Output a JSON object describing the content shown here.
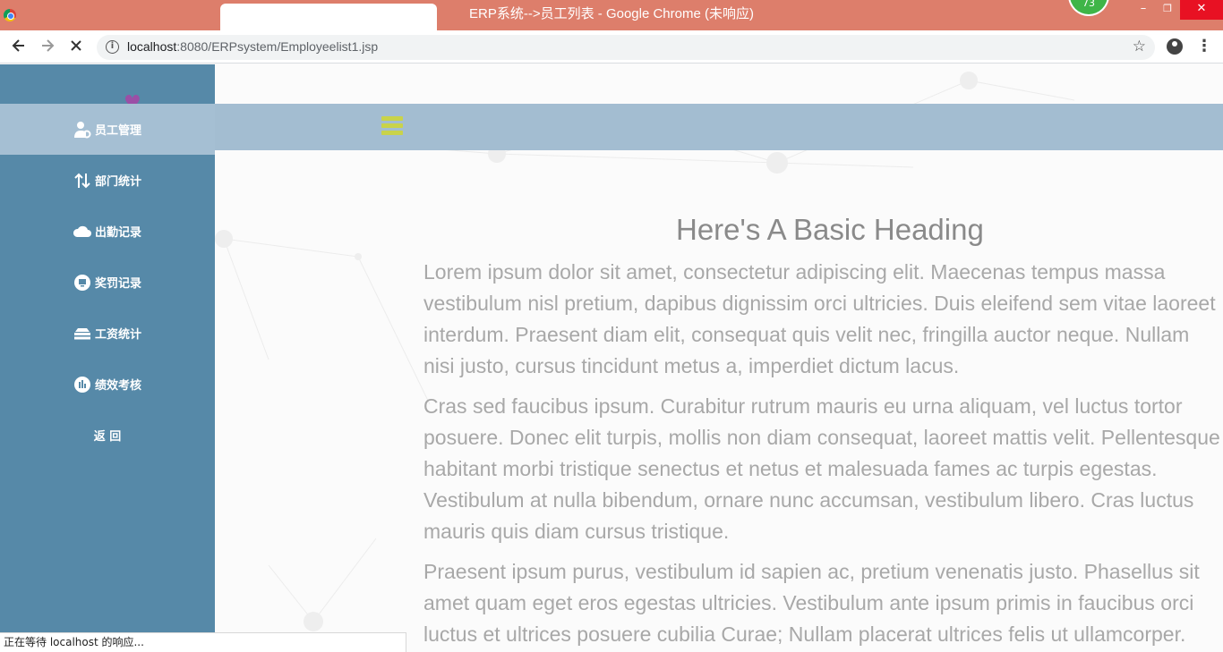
{
  "window": {
    "title": "ERP系统-->员工列表 - Google Chrome (未响应)",
    "badge_count": "73",
    "min_glyph": "–",
    "max_glyph": "❐",
    "close_glyph": "✕"
  },
  "toolbar": {
    "url_host": "localhost",
    "url_rest": ":8080/ERPsystem/Employeelist1.jsp"
  },
  "sidebar": {
    "items": [
      {
        "label": "员工管理",
        "icon": "user-gear-icon"
      },
      {
        "label": "部门统计",
        "icon": "swap-arrows-icon"
      },
      {
        "label": "出勤记录",
        "icon": "cloud-icon"
      },
      {
        "label": "奖罚记录",
        "icon": "monitor-icon"
      },
      {
        "label": "工资统计",
        "icon": "stack-icon"
      },
      {
        "label": "绩效考核",
        "icon": "bar-chart-icon"
      },
      {
        "label": "返 回",
        "icon": ""
      }
    ]
  },
  "main": {
    "heading": "Here's A Basic Heading",
    "p1": [
      "Lorem ipsum dolor sit amet, consectetur adipiscing elit. Maecenas tempus massa",
      "vestibulum nisl pretium, dapibus dignissim orci ultricies. Duis eleifend sem vitae laoreet",
      "interdum. Praesent diam elit, consequat quis velit nec, fringilla auctor neque. Nullam",
      "nisi justo, cursus tincidunt metus a, imperdiet dictum lacus."
    ],
    "p2": [
      "Cras sed faucibus ipsum. Curabitur rutrum mauris eu urna aliquam, vel luctus tortor",
      "posuere. Donec elit turpis, mollis non diam consequat, laoreet mattis velit. Pellentesque",
      "habitant morbi tristique senectus et netus et malesuada fames ac turpis egestas.",
      "Vestibulum at nulla bibendum, ornare nunc accumsan, vestibulum libero. Cras luctus",
      "mauris quis diam cursus tristique."
    ],
    "p3": [
      "Praesent ipsum purus, vestibulum id sapien ac, pretium venenatis justo. Phasellus sit",
      "amet quam eget eros egestas ultricies. Vestibulum ante ipsum primis in faucibus orci",
      "luctus et ultrices posuere cubilia Curae; Nullam placerat ultrices felis ut ullamcorper."
    ]
  },
  "status_bar": {
    "text": "正在等待 localhost 的响应..."
  },
  "colors": {
    "titlebar": "#dd7e6b",
    "sidebar": "#5689a8",
    "sidebar_active": "#a5bfd3",
    "topbar": "#a3bdd1",
    "hamburger": "#c9d34a",
    "heart": "#9b4fa6"
  }
}
